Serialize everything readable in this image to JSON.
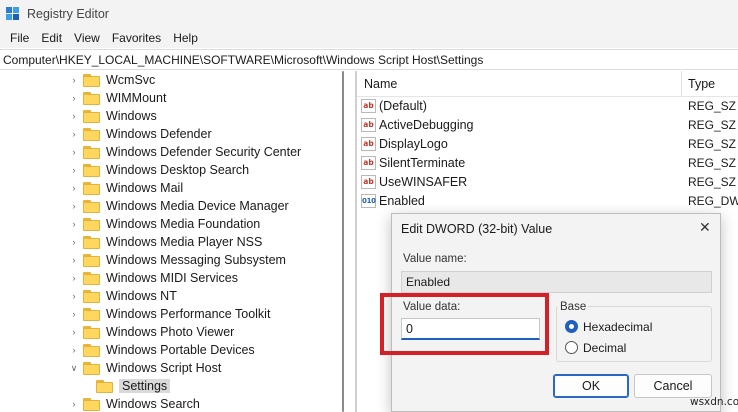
{
  "window": {
    "title": "Registry Editor"
  },
  "menu": [
    "File",
    "Edit",
    "View",
    "Favorites",
    "Help"
  ],
  "address": "Computer\\HKEY_LOCAL_MACHINE\\SOFTWARE\\Microsoft\\Windows Script Host\\Settings",
  "tree": {
    "items": [
      {
        "label": "WcmSvc",
        "chevron": ">"
      },
      {
        "label": "WIMMount",
        "chevron": ">"
      },
      {
        "label": "Windows",
        "chevron": ">"
      },
      {
        "label": "Windows Defender",
        "chevron": ">"
      },
      {
        "label": "Windows Defender Security Center",
        "chevron": ">"
      },
      {
        "label": "Windows Desktop Search",
        "chevron": ">"
      },
      {
        "label": "Windows Mail",
        "chevron": ">"
      },
      {
        "label": "Windows Media Device Manager",
        "chevron": ">"
      },
      {
        "label": "Windows Media Foundation",
        "chevron": ">"
      },
      {
        "label": "Windows Media Player NSS",
        "chevron": ">"
      },
      {
        "label": "Windows Messaging Subsystem",
        "chevron": ">"
      },
      {
        "label": "Windows MIDI Services",
        "chevron": ">"
      },
      {
        "label": "Windows NT",
        "chevron": ">"
      },
      {
        "label": "Windows Performance Toolkit",
        "chevron": ">"
      },
      {
        "label": "Windows Photo Viewer",
        "chevron": ">"
      },
      {
        "label": "Windows Portable Devices",
        "chevron": ">"
      },
      {
        "label": "Windows Script Host",
        "chevron": "v"
      },
      {
        "label": "Settings",
        "chevron": "",
        "selected": true
      },
      {
        "label": "Windows Search",
        "chevron": ">"
      }
    ]
  },
  "list": {
    "columns": {
      "name": "Name",
      "type": "Type"
    },
    "rows": [
      {
        "icon": "string-value-icon",
        "glyph": "ab",
        "name": "(Default)",
        "type": "REG_SZ"
      },
      {
        "icon": "string-value-icon",
        "glyph": "ab",
        "name": "ActiveDebugging",
        "type": "REG_SZ"
      },
      {
        "icon": "string-value-icon",
        "glyph": "ab",
        "name": "DisplayLogo",
        "type": "REG_SZ"
      },
      {
        "icon": "string-value-icon",
        "glyph": "ab",
        "name": "SilentTerminate",
        "type": "REG_SZ"
      },
      {
        "icon": "string-value-icon",
        "glyph": "ab",
        "name": "UseWINSAFER",
        "type": "REG_SZ"
      },
      {
        "icon": "dword-value-icon",
        "glyph": "010",
        "name": "Enabled",
        "type": "REG_DWORD"
      }
    ]
  },
  "dialog": {
    "title": "Edit DWORD (32-bit) Value",
    "close_glyph": "✕",
    "value_name_label": "Value name:",
    "value_name": "Enabled",
    "value_data_label": "Value data:",
    "value_data": "0",
    "base_label": "Base",
    "hex_label": "Hexadecimal",
    "dec_label": "Decimal",
    "base_selected": "Hexadecimal",
    "ok_label": "OK",
    "cancel_label": "Cancel"
  },
  "watermark": "wsxdn.com",
  "colors": {
    "highlight": "#d42027",
    "accent": "#1f5fbf"
  }
}
